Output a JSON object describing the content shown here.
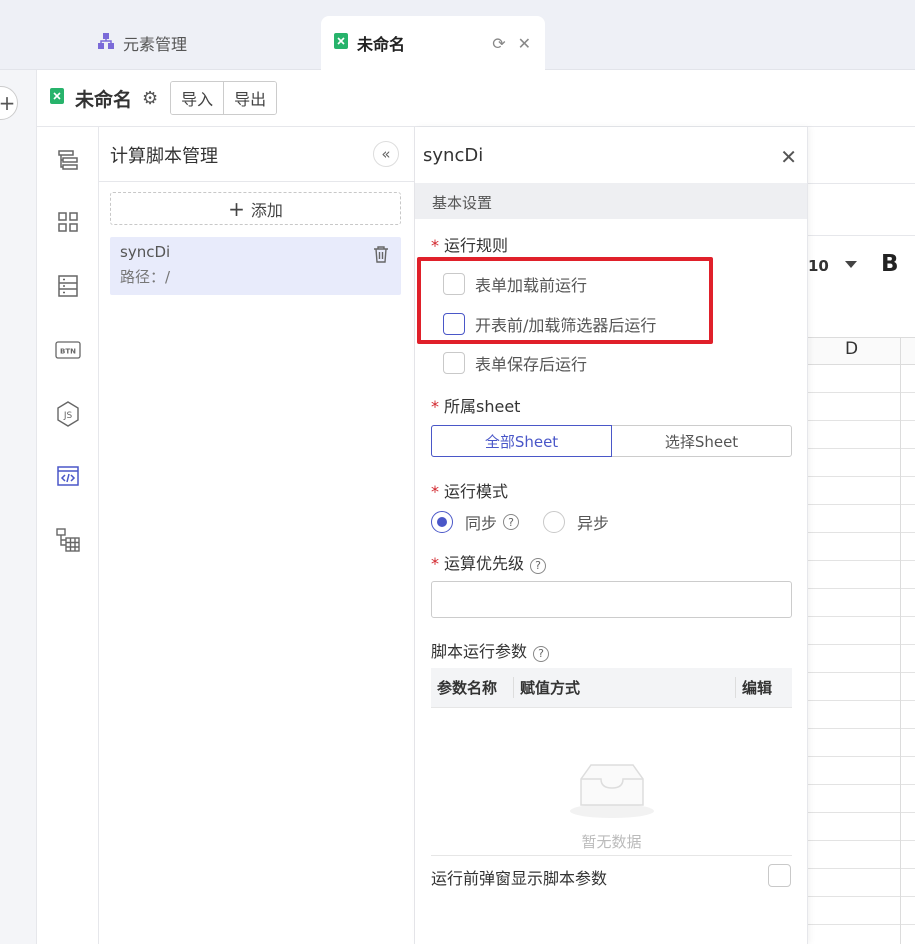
{
  "tabs": [
    {
      "label": "元素管理",
      "icon": "sitemap-icon"
    },
    {
      "label": "未命名",
      "icon": "excel-file-icon",
      "active": true
    }
  ],
  "doc": {
    "name": "未命名",
    "import_label": "导入",
    "export_label": "导出"
  },
  "rail_icons": [
    "layers-icon",
    "grid-icon",
    "form-icon",
    "btn-icon",
    "js-icon",
    "code-window-icon",
    "table-tree-icon"
  ],
  "script_panel": {
    "title": "计算脚本管理",
    "add_label": "添加",
    "items": [
      {
        "name": "syncDi",
        "path": "路径：/"
      }
    ]
  },
  "sheet": {
    "font_size": "10",
    "bold_label": "B",
    "column_label": "D"
  },
  "config": {
    "title": "syncDi",
    "section": "基本设置",
    "run_rules_label": "运行规则",
    "run_rules": [
      {
        "label": "表单加载前运行",
        "checked": false
      },
      {
        "label": "开表前/加载筛选器后运行",
        "checked": false
      },
      {
        "label": "表单保存后运行",
        "checked": false
      }
    ],
    "sheet_label": "所属sheet",
    "sheet_options": [
      "全部Sheet",
      "选择Sheet"
    ],
    "sheet_selected": "全部Sheet",
    "mode_label": "运行模式",
    "mode_options": [
      "同步",
      "异步"
    ],
    "mode_selected": "同步",
    "priority_label": "运算优先级",
    "priority_value": "",
    "params_label": "脚本运行参数",
    "params_columns": [
      "参数名称",
      "赋值方式",
      "编辑"
    ],
    "params_empty": "暂无数据",
    "popup_label": "运行前弹窗显示脚本参数"
  },
  "colors": {
    "accent": "#4a57c8",
    "highlight_frame": "#e0202a",
    "required": "#d2252c"
  }
}
